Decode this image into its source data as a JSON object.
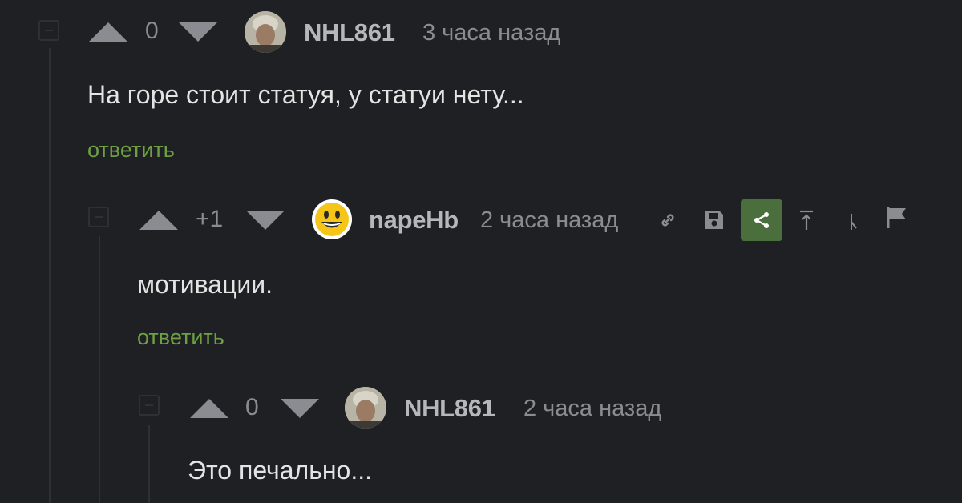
{
  "comments": [
    {
      "rating": "0",
      "username": "NHL861",
      "time": "3 часа назад",
      "text": "На горе стоит статуя, у статуи нету...",
      "reply_label": "ответить"
    },
    {
      "rating": "+1",
      "username": "napeHb",
      "time": "2 часа назад",
      "text": "мотивации.",
      "reply_label": "ответить"
    },
    {
      "rating": "0",
      "username": "NHL861",
      "time": "2 часа назад",
      "text": "Это печально..."
    }
  ],
  "colors": {
    "background": "#1f2023",
    "reply_link": "#6ea043",
    "share_button": "#4a6e3c"
  },
  "toolbar_icons": [
    "link-icon",
    "save-icon",
    "share-icon",
    "scroll-top-icon",
    "branch-icon",
    "report-flag-icon"
  ]
}
